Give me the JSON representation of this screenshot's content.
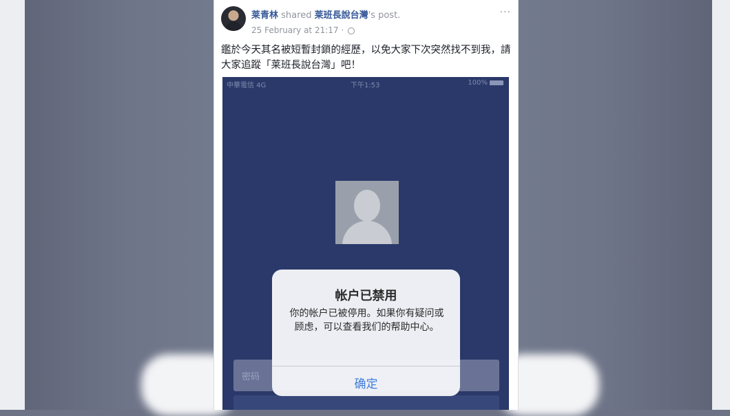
{
  "post": {
    "author": "莱青林",
    "shared_word": "shared",
    "page_name": "莱班長說台灣",
    "possessive": "'s post.",
    "timestamp": "25 February at 21:17 ·",
    "more": "···",
    "text": "鑑於今天其名被短暫封鎖的經歷，以免大家下次突然找不到我，請大家追蹤「莱班長說台灣」吧！"
  },
  "phone": {
    "status_bar": {
      "carrier": "中華電信  4G",
      "time": "下午1:53",
      "battery": "100%"
    },
    "password_placeholder": "密码",
    "alert": {
      "title": "帐户已禁用",
      "message": "你的帐户已被停用。如果你有疑问或顾虑，可以查看我们的帮助中心。",
      "ok_label": "确定"
    }
  }
}
